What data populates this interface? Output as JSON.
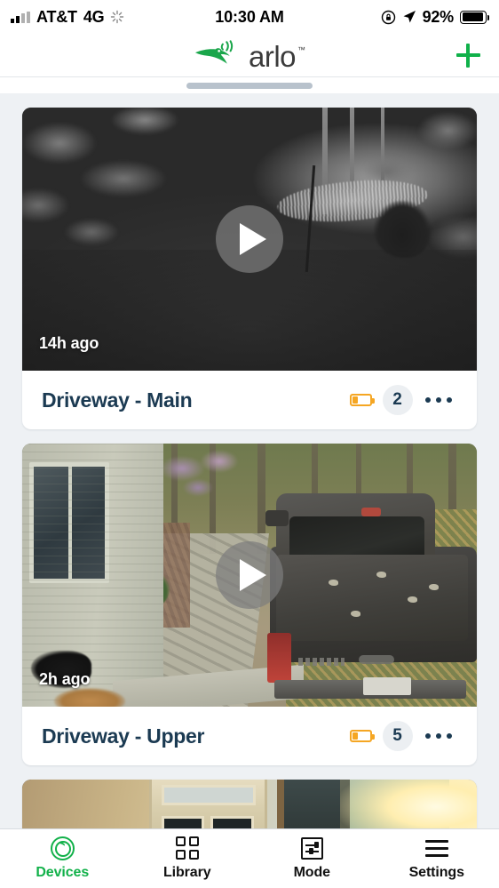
{
  "status_bar": {
    "carrier": "AT&T",
    "network": "4G",
    "time": "10:30 AM",
    "battery_percent": "92%",
    "icons": [
      "signal-bars-icon",
      "activity-spinner-icon",
      "rotation-lock-icon",
      "location-arrow-icon",
      "battery-icon"
    ]
  },
  "header": {
    "brand": "arlo",
    "trademark": "™",
    "add_label": "+",
    "logo_color": "#12b14a",
    "wordmark_color": "#3b3b3b"
  },
  "theme": {
    "page_background": "#eef1f4",
    "card_background": "#ffffff",
    "title_color": "#1b3a52",
    "accent_green": "#12b14a",
    "battery_low_color": "#f5a623",
    "badge_background": "#eceff2"
  },
  "devices": [
    {
      "name": "Driveway - Main",
      "last_event": "14h ago",
      "battery_state": "low",
      "library_count": "2",
      "thumbnail": "night-vision-driveway-grayscale",
      "play_label": "▶",
      "more_label": "•••"
    },
    {
      "name": "Driveway - Upper",
      "last_event": "2h ago",
      "battery_state": "low",
      "library_count": "5",
      "thumbnail": "daytime-driveway-pickup-truck-dog",
      "play_label": "▶",
      "more_label": "•••"
    },
    {
      "name": "",
      "last_event": "",
      "battery_state": "",
      "library_count": "",
      "thumbnail": "indoor-room-cabinet-door-sunlight",
      "play_label": "",
      "more_label": ""
    }
  ],
  "tab_bar": {
    "items": [
      {
        "label": "Devices",
        "icon": "camera-lens-icon",
        "active": true
      },
      {
        "label": "Library",
        "icon": "grid-squares-icon",
        "active": false
      },
      {
        "label": "Mode",
        "icon": "sliders-box-icon",
        "active": false
      },
      {
        "label": "Settings",
        "icon": "hamburger-menu-icon",
        "active": false
      }
    ]
  }
}
